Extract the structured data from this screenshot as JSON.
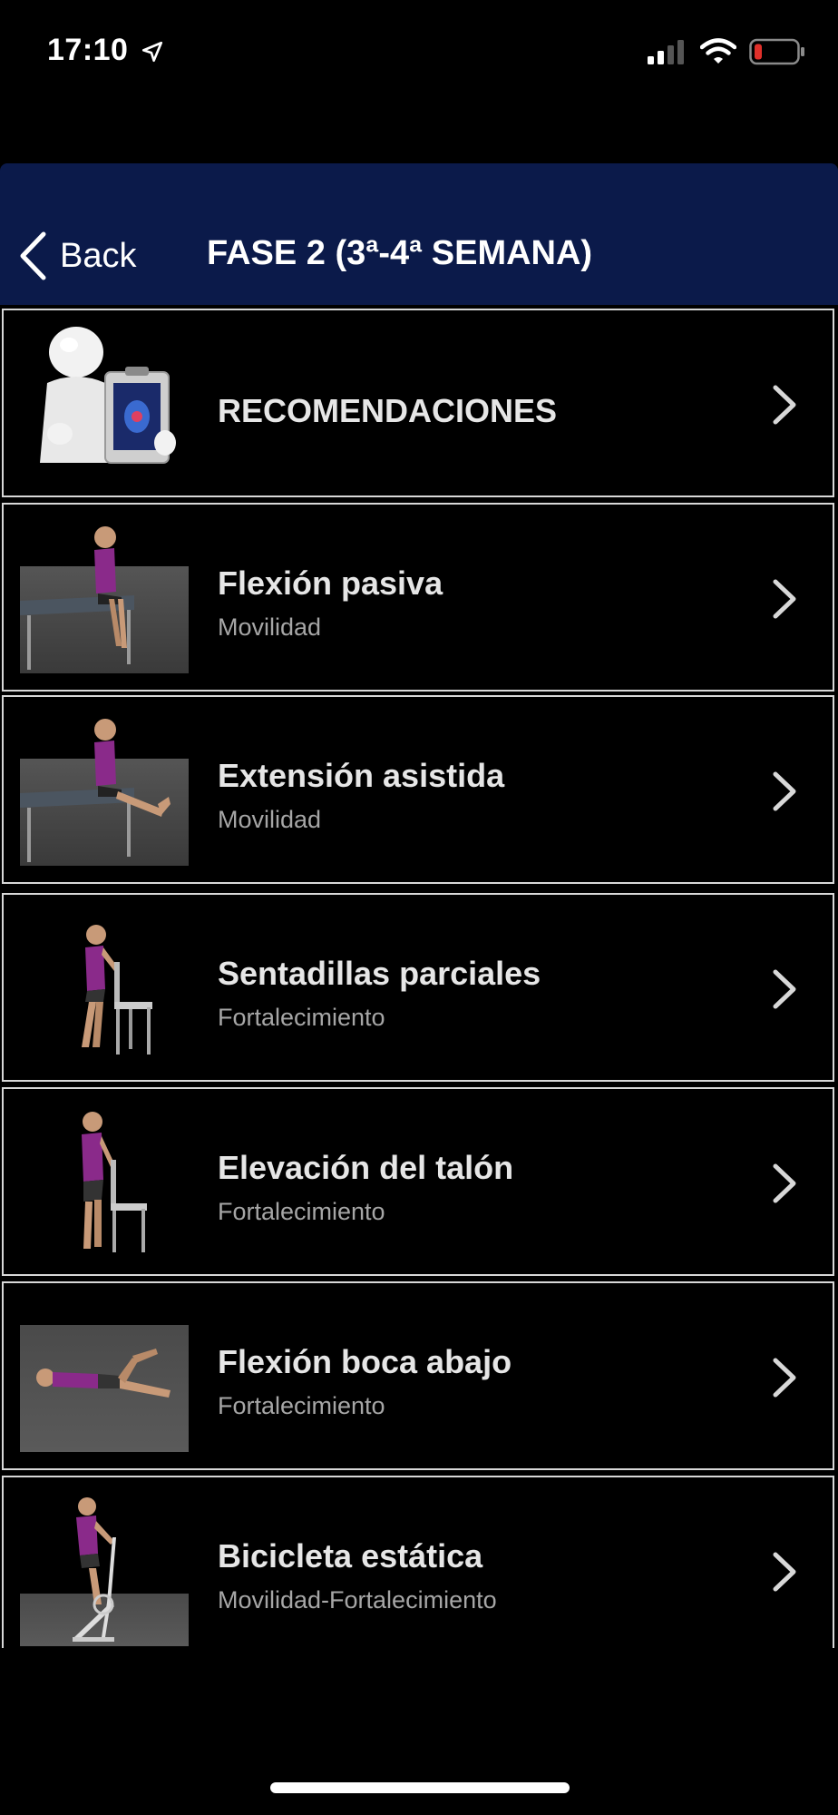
{
  "status_bar": {
    "time": "17:10",
    "battery_color": "#e0302a",
    "icons": [
      "location-arrow-icon",
      "signal-icon",
      "wifi-icon",
      "battery-icon"
    ]
  },
  "nav": {
    "back_label": "Back",
    "title": "FASE 2 (3ª-4ª SEMANA)",
    "background": "#0b1a4a"
  },
  "items": [
    {
      "title": "RECOMENDACIONES",
      "subtitle": "",
      "thumb": "doctor-figure"
    },
    {
      "title": "Flexión pasiva",
      "subtitle": "Movilidad",
      "thumb": "sitting-table"
    },
    {
      "title": "Extensión asistida",
      "subtitle": "Movilidad",
      "thumb": "sitting-table-extended"
    },
    {
      "title": "Sentadillas parciales",
      "subtitle": "Fortalecimiento",
      "thumb": "squat-chair"
    },
    {
      "title": "Elevación del talón",
      "subtitle": "Fortalecimiento",
      "thumb": "standing-chair"
    },
    {
      "title": "Flexión boca abajo",
      "subtitle": "Fortalecimiento",
      "thumb": "lying-prone"
    },
    {
      "title": "Bicicleta estática",
      "subtitle": "Movilidad-Fortalecimiento",
      "thumb": "stationary-bike"
    }
  ]
}
